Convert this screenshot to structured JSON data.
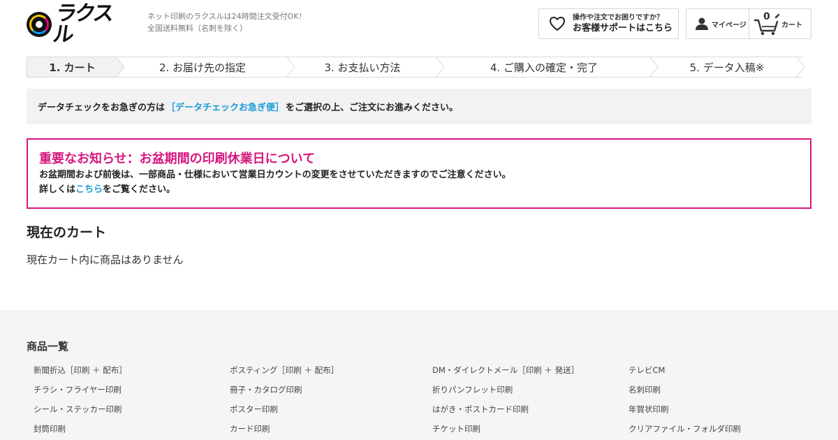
{
  "header": {
    "logo_text": "ラクスル",
    "tagline_1": "ネット印刷のラクスルは24時間注文受付OK！",
    "tagline_2": "全国送料無料（名刺を除く）",
    "support_small": "操作や注文でお困りですか？",
    "support_main": "お客様サポートはこちら",
    "mypage_label": "マイページ",
    "cart_label": "カート",
    "cart_count": "0"
  },
  "steps": [
    {
      "label": "1. カート",
      "active": true
    },
    {
      "label": "2. お届け先の指定",
      "active": false
    },
    {
      "label": "3. お支払い方法",
      "active": false
    },
    {
      "label": "4. ご購入の確定・完了",
      "active": false
    },
    {
      "label": "5. データ入稿※",
      "active": false
    }
  ],
  "info_band": {
    "prefix": "データチェックをお急ぎの方は",
    "link": "［データチェックお急ぎ便］",
    "suffix": "をご選択の上、ご注文にお進みください。"
  },
  "notice": {
    "title": "重要なお知らせ：お盆期間の印刷休業日について",
    "line1": "お盆期間および前後は、一部商品・仕様において営業日カウントの変更をさせていただきますのでご注意ください。",
    "line2_prefix": "詳しくは",
    "line2_link": "こちら",
    "line2_suffix": "をご覧ください。"
  },
  "cart": {
    "heading": "現在のカート",
    "empty_message": "現在カート内に商品はありません"
  },
  "footer": {
    "title": "商品一覧",
    "columns": [
      [
        "新聞折込［印刷 ＋ 配布］",
        "チラシ・フライヤー印刷",
        "シール・ステッカー印刷",
        "封筒印刷"
      ],
      [
        "ポスティング［印刷 ＋ 配布］",
        "冊子・カタログ印刷",
        "ポスター印刷",
        "カード印刷"
      ],
      [
        "DM・ダイレクトメール［印刷 ＋ 発送］",
        "折りパンフレット印刷",
        "はがき・ポストカード印刷",
        "チケット印刷"
      ],
      [
        "テレビCM",
        "名刺印刷",
        "年賀状印刷",
        "クリアファイル・フォルダ印刷"
      ]
    ]
  },
  "colors": {
    "accent_pink": "#d6177e",
    "link_blue": "#1a9bd7"
  },
  "icons": {
    "logo": "raksul-logo-icon",
    "support": "heart-icon",
    "mypage": "user-icon",
    "cart": "cart-icon"
  }
}
